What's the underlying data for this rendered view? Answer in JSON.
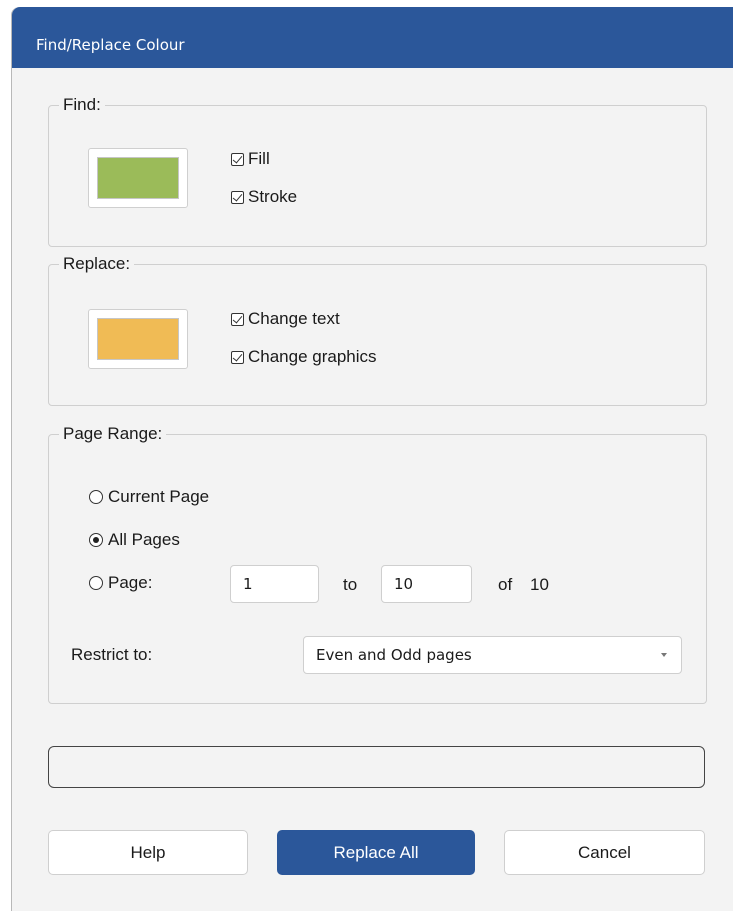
{
  "dialog": {
    "title": "Find/Replace Colour"
  },
  "find": {
    "legend": "Find:",
    "swatch_color": "#9bbb59",
    "fill_label": "Fill",
    "stroke_label": "Stroke",
    "fill_checked": true,
    "stroke_checked": true
  },
  "replace": {
    "legend": "Replace:",
    "swatch_color": "#f0bb55",
    "change_text_label": "Change text",
    "change_graphics_label": "Change graphics",
    "change_text_checked": true,
    "change_graphics_checked": true
  },
  "page_range": {
    "legend": "Page Range:",
    "current_page_label": "Current Page",
    "all_pages_label": "All Pages",
    "page_label": "Page:",
    "selected": "all_pages",
    "from_value": "1",
    "to_label": "to",
    "to_value": "10",
    "of_label": "of",
    "total_pages": "10",
    "restrict_label": "Restrict to:",
    "restrict_value": "Even and Odd pages"
  },
  "progress": {
    "value": 0
  },
  "buttons": {
    "help": "Help",
    "replace_all": "Replace All",
    "cancel": "Cancel"
  },
  "colors": {
    "accent": "#2b579a",
    "find_swatch": "#9bbb59",
    "replace_swatch": "#f0bb55"
  }
}
